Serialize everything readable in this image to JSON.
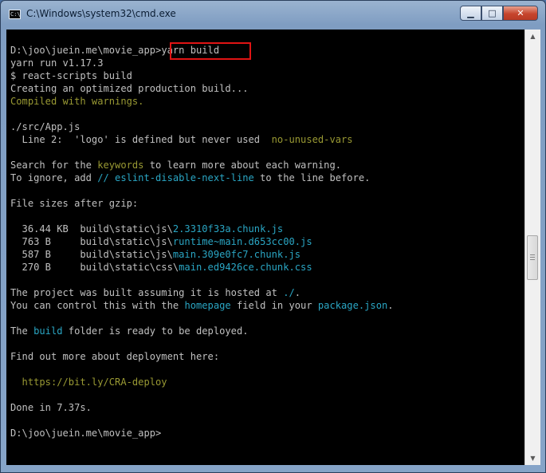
{
  "window": {
    "title": "C:\\Windows\\system32\\cmd.exe",
    "icon_text": "C:\\",
    "controls": {
      "minimize": "▁",
      "maximize": "□",
      "close": "✕"
    }
  },
  "highlight": {
    "color": "#e01414"
  },
  "colors": {
    "background": "#000000",
    "text": "#c0c0c0",
    "yellow": "#999933",
    "cyan": "#2aa6c4"
  },
  "console": {
    "prompt1": "D:\\joo\\juein.me\\movie_app>",
    "command": "yarn build",
    "yarn_version": "yarn run v1.17.3",
    "script_run": "$ react-scripts build",
    "creating": "Creating an optimized production build...",
    "compiled_warnings": "Compiled with warnings.",
    "file": "./src/App.js",
    "warn_prefix": "  Line 2:  'logo' is defined but never used  ",
    "warn_rule": "no-unused-vars",
    "search_a": "Search for the ",
    "keywords": "keywords",
    "search_b": " to learn more about each warning.",
    "ignore_a": "To ignore, add ",
    "ignore_comment": "// eslint-disable-next-line",
    "ignore_b": " to the line before.",
    "sizes_header": "File sizes after gzip:",
    "files": [
      {
        "size": "  36.44 KB  ",
        "dir": "build\\static\\js\\",
        "name": "2.3310f33a.chunk.js"
      },
      {
        "size": "  763 B     ",
        "dir": "build\\static\\js\\",
        "name": "runtime~main.d653cc00.js"
      },
      {
        "size": "  587 B     ",
        "dir": "build\\static\\js\\",
        "name": "main.309e0fc7.chunk.js"
      },
      {
        "size": "  270 B     ",
        "dir": "build\\static\\css\\",
        "name": "main.ed9426ce.chunk.css"
      }
    ],
    "hosted_a": "The project was built assuming it is hosted at ",
    "hosted_path": "./",
    "hosted_b": ".",
    "control_a": "You can control this with the ",
    "homepage": "homepage",
    "control_b": " field in your ",
    "package_json": "package.json",
    "control_c": ".",
    "build_a": "The ",
    "build_word": "build",
    "build_b": " folder is ready to be deployed.",
    "deploy_more": "Find out more about deployment here:",
    "deploy_url": "  https://bit.ly/CRA-deploy",
    "done": "Done in 7.37s.",
    "prompt2": "D:\\joo\\juein.me\\movie_app>"
  },
  "scrollbar": {
    "up_icon": "▲",
    "down_icon": "▼"
  }
}
